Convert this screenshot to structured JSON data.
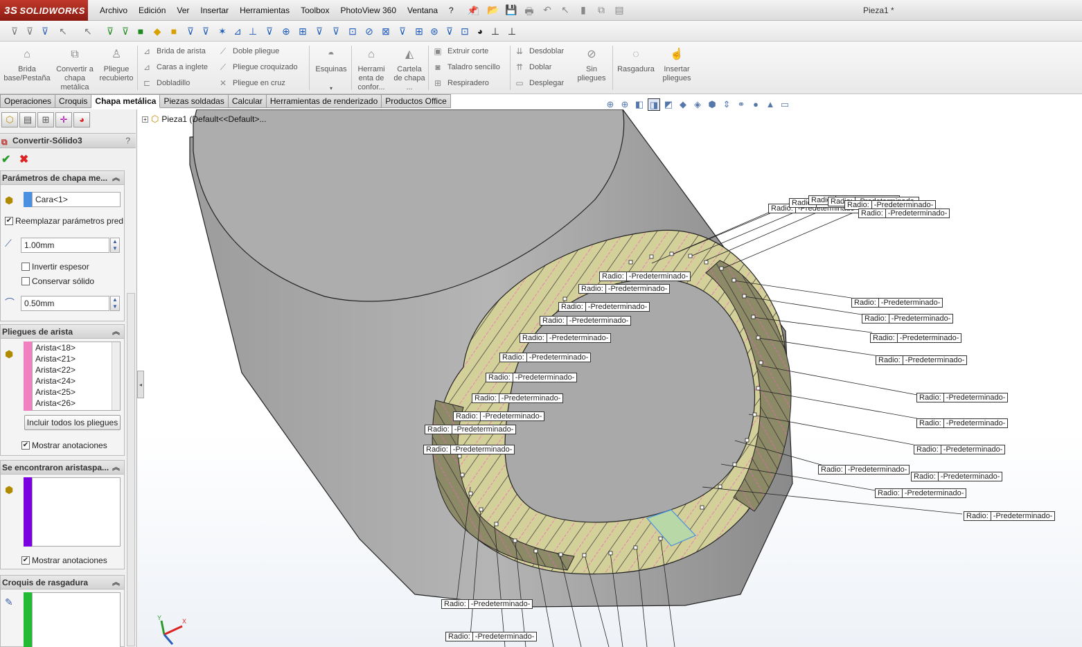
{
  "app": {
    "logo": "SOLIDWORKS",
    "logo_prefix": "3S",
    "doc_title": "Pieza1 *"
  },
  "menu": [
    "Archivo",
    "Edición",
    "Ver",
    "Insertar",
    "Herramientas",
    "Toolbox",
    "PhotoView 360",
    "Ventana",
    "?"
  ],
  "command_manager": {
    "big": [
      {
        "id": "brida-base",
        "label": "Brida base/Pestaña"
      },
      {
        "id": "convertir",
        "label": "Convertir a chapa metálica"
      },
      {
        "id": "pliegue-recubierto",
        "label": "Pliegue recubierto"
      },
      {
        "id": "esquinas",
        "label": "Esquinas"
      },
      {
        "id": "herramienta",
        "label": "Herrami enta de confor..."
      },
      {
        "id": "cartela",
        "label": "Cartela de chapa ..."
      },
      {
        "id": "sin-pliegues",
        "label": "Sin pliegues"
      },
      {
        "id": "rasgadura",
        "label": "Rasgadura"
      },
      {
        "id": "insertar-pliegues",
        "label": "Insertar pliegues"
      }
    ],
    "small": [
      "Brida de arista",
      "Caras a inglete",
      "Dobladillo",
      "Doble pliegue",
      "Pliegue croquizado",
      "Pliegue en cruz",
      "Extruir corte",
      "Taladro sencillo",
      "Respiradero",
      "Desdoblar",
      "Doblar",
      "Desplegar"
    ]
  },
  "tabs": [
    "Operaciones",
    "Croquis",
    "Chapa metálica",
    "Piezas soldadas",
    "Calcular",
    "Herramientas de renderizado",
    "Productos Office"
  ],
  "active_tab": "Chapa metálica",
  "tree": {
    "label": "Pieza1  (Default<<Default>..."
  },
  "property_manager": {
    "title": "Convertir-Sólido3",
    "help": "?",
    "ok": "✔",
    "cancel": "✖",
    "group1": {
      "title": "Parámetros de chapa me...",
      "face": "Cara<1>",
      "replace_params": "Reemplazar parámetros pred",
      "thickness": "1.00mm",
      "invert_thickness": "Invertir espesor",
      "keep_solid": "Conservar sólido",
      "radius": "0.50mm"
    },
    "group2": {
      "title": "Pliegues de arista",
      "edges": [
        "Arista<18>",
        "Arista<21>",
        "Arista<22>",
        "Arista<24>",
        "Arista<25>",
        "Arista<26>"
      ],
      "include_all": "Incluir todos los pliegues",
      "show_annotations": "Mostrar anotaciones"
    },
    "group3": {
      "title": "Se encontraron aristaspa...",
      "show_annotations": "Mostrar anotaciones"
    },
    "group4": {
      "title": "Croquis de rasgadura"
    }
  },
  "annotation": {
    "key": "Radio:",
    "value": "-Predeterminado-"
  },
  "colors": {
    "face_blue": "#4a8fe0",
    "edges_pink": "#f080c0",
    "found_purple": "#7a00e0",
    "rip_green": "#22bb33"
  }
}
